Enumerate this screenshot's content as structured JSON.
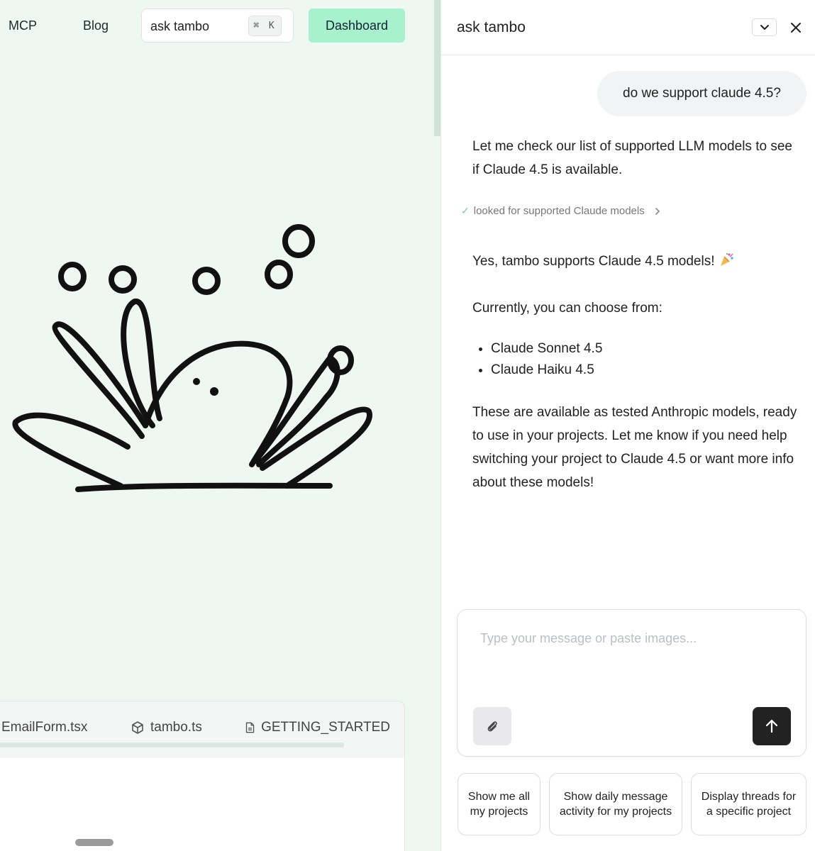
{
  "nav": {
    "links": [
      "MCP",
      "Blog"
    ],
    "search_label": "ask tambo",
    "search_shortcut": "⌘ K",
    "dashboard_label": "Dashboard"
  },
  "file_tabs": [
    "EmailForm.tsx",
    "tambo.ts",
    "GETTING_STARTED"
  ],
  "panel": {
    "title": "ask tambo",
    "user_message": "do we support claude 4.5?",
    "assistant": {
      "intro": "Let me check our list of supported LLM models to see if Claude 4.5 is available.",
      "tool_status": "looked for supported Claude models",
      "answer": "Yes, tambo supports Claude 4.5 models!",
      "choose": "Currently, you can choose from:",
      "models": [
        "Claude Sonnet 4.5",
        "Claude Haiku 4.5"
      ],
      "closing": "These are available as tested Anthropic models, ready to use in your projects. Let me know if you need help switching your project to Claude 4.5 or want more info about these models!"
    },
    "composer_placeholder": "Type your message or paste images...",
    "suggestions": [
      "Show me all my projects",
      "Show daily message activity for my projects",
      "Display threads for a specific project"
    ]
  },
  "colors": {
    "page_bg": "#eff7f2",
    "accent": "#a7f2cd",
    "send_button": "#222222",
    "check": "#7fc79a"
  },
  "icons": [
    "search-shortcut",
    "collapse-chevron-icon",
    "close-icon",
    "check-icon",
    "chevron-right-icon",
    "party-popper-icon",
    "box-icon",
    "file-icon",
    "paperclip-icon",
    "arrow-up-icon"
  ]
}
